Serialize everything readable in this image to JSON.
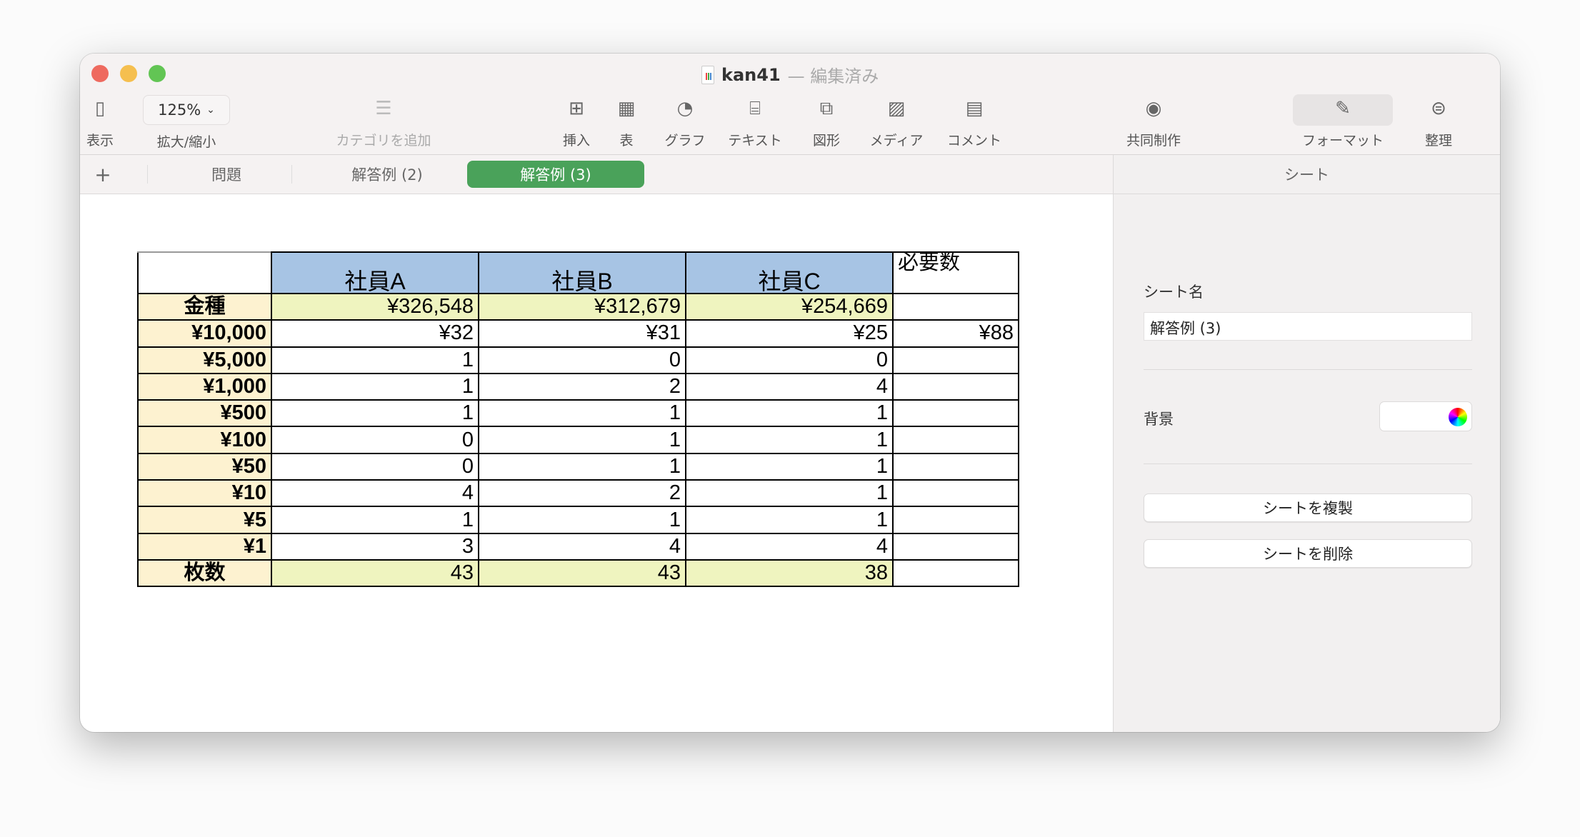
{
  "window": {
    "doc_name": "kan41",
    "status": "— 編集済み"
  },
  "toolbar": {
    "view": "表示",
    "zoom_value": "125%",
    "zoom": "拡大/縮小",
    "category": "カテゴリを追加",
    "insert": "挿入",
    "table": "表",
    "chart": "グラフ",
    "text": "テキスト",
    "shape": "図形",
    "media": "メディア",
    "comment": "コメント",
    "collaborate": "共同制作",
    "format": "フォーマット",
    "organize": "整理"
  },
  "tabs": {
    "add": "+",
    "items": [
      "問題",
      "解答例 (2)",
      "解答例 (3)"
    ],
    "active": 2
  },
  "sidebar": {
    "header": "シート",
    "sheet_name_label": "シート名",
    "sheet_name_value": "解答例 (3)",
    "background_label": "背景",
    "duplicate": "シートを複製",
    "delete": "シートを削除"
  },
  "sheet": {
    "headers": [
      "",
      "社員A",
      "社員B",
      "社員C",
      "必要数"
    ],
    "rows": [
      [
        "金種",
        "¥326,548",
        "¥312,679",
        "¥254,669",
        ""
      ],
      [
        "¥10,000",
        "¥32",
        "¥31",
        "¥25",
        "¥88"
      ],
      [
        "¥5,000",
        "1",
        "0",
        "0",
        ""
      ],
      [
        "¥1,000",
        "1",
        "2",
        "4",
        ""
      ],
      [
        "¥500",
        "1",
        "1",
        "1",
        ""
      ],
      [
        "¥100",
        "0",
        "1",
        "1",
        ""
      ],
      [
        "¥50",
        "0",
        "1",
        "1",
        ""
      ],
      [
        "¥10",
        "4",
        "2",
        "1",
        ""
      ],
      [
        "¥5",
        "1",
        "1",
        "1",
        ""
      ],
      [
        "¥1",
        "3",
        "4",
        "4",
        ""
      ],
      [
        "枚数",
        "43",
        "43",
        "38",
        ""
      ]
    ]
  },
  "colors": {
    "accent": "#4aa25a",
    "header_fill": "#a7c4e4",
    "label_fill": "#fdf2d0",
    "total_fill": "#eff4bf"
  }
}
